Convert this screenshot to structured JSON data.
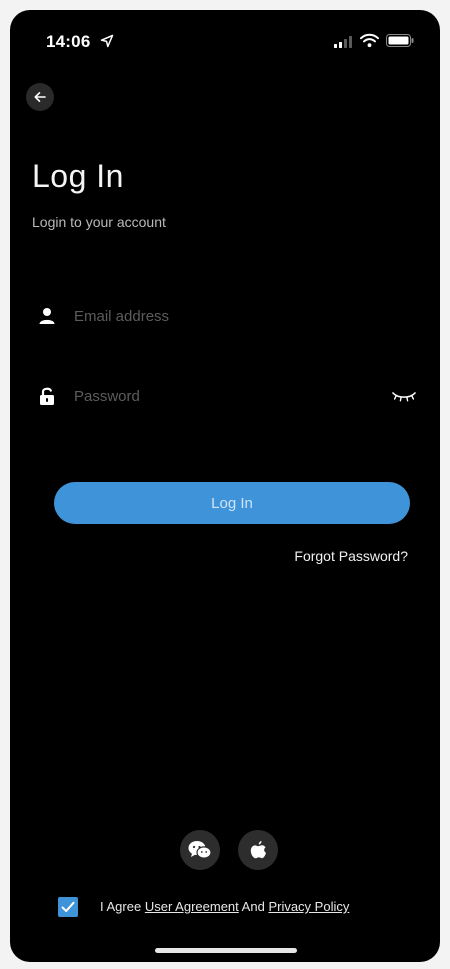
{
  "status_bar": {
    "time": "14:06",
    "icons": [
      "location-arrow-icon",
      "cellular-signal-icon",
      "wifi-icon",
      "battery-icon"
    ]
  },
  "nav": {
    "back_icon": "arrow-left-icon"
  },
  "header": {
    "title": "Log In",
    "subtitle": "Login to your account"
  },
  "form": {
    "email": {
      "placeholder": "Email address",
      "value": "",
      "icon": "user-icon"
    },
    "password": {
      "placeholder": "Password",
      "value": "",
      "icon": "lock-icon",
      "toggle_icon": "eye-closed-icon"
    },
    "submit_label": "Log In",
    "forgot_label": "Forgot Password?"
  },
  "social_login": {
    "providers": [
      {
        "name": "WeChat",
        "icon": "wechat-icon"
      },
      {
        "name": "Apple",
        "icon": "apple-icon"
      }
    ]
  },
  "agreement": {
    "checked": true,
    "prefix": "I Agree",
    "user_agreement": "User Agreement",
    "conjunction": "And",
    "privacy_policy": "Privacy Policy"
  },
  "colors": {
    "background": "#000000",
    "accent": "#3f93d9",
    "placeholder": "#5c5c5c",
    "subtitle": "#b9b9b9"
  }
}
